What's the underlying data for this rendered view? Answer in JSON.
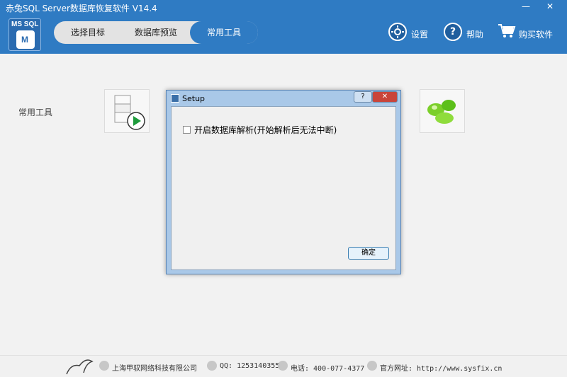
{
  "window": {
    "title": "赤兔SQL Server数据库恢复软件 V14.4",
    "minimize": "—",
    "close": "✕"
  },
  "logo": {
    "line1": "MS SQL",
    "line2": "M"
  },
  "tabs": [
    {
      "label": "选择目标",
      "active": false
    },
    {
      "label": "数据库预览",
      "active": false
    },
    {
      "label": "常用工具",
      "active": true
    }
  ],
  "header_actions": {
    "settings": "设置",
    "help": "帮助",
    "buy": "购买软件"
  },
  "main": {
    "section_label": "常用工具"
  },
  "dialog": {
    "title": "Setup",
    "help_button": "?",
    "close_button": "✕",
    "checkbox_label": "开启数据库解析(开始解析后无法中断)",
    "checkbox_checked": false,
    "ok_button": "确定"
  },
  "footer": {
    "company": "上海甲驭网络科技有限公司",
    "qq": "QQ: 1253140355",
    "phone": "电话: 400-077-4377",
    "website": "官方网址: http://www.sysfix.cn"
  },
  "colors": {
    "brand": "#2f7bc3",
    "dialog_frame": "#a9c8e8"
  }
}
